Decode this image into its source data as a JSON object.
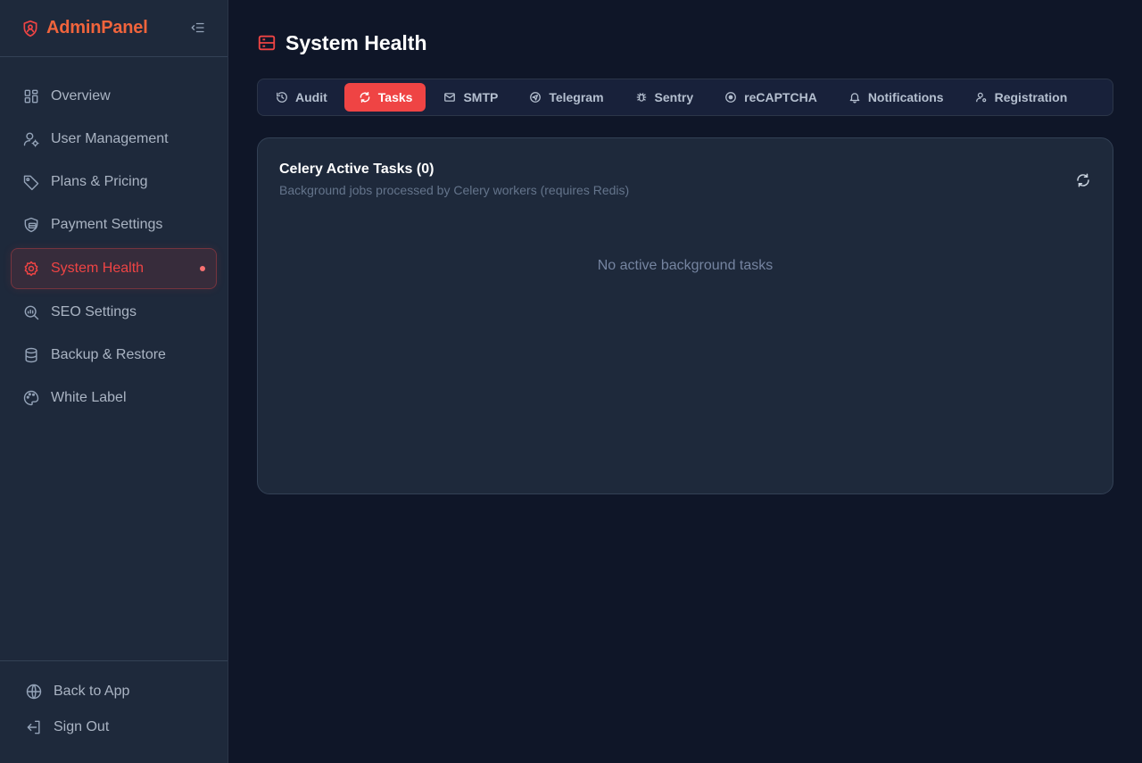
{
  "brand": {
    "name": "AdminPanel"
  },
  "sidebar": {
    "items": [
      {
        "label": "Overview",
        "icon": "grid-icon"
      },
      {
        "label": "User Management",
        "icon": "user-gear-icon"
      },
      {
        "label": "Plans & Pricing",
        "icon": "tag-icon"
      },
      {
        "label": "Payment Settings",
        "icon": "wallet-icon"
      },
      {
        "label": "System Health",
        "icon": "gear-icon",
        "active": true
      },
      {
        "label": "SEO Settings",
        "icon": "search-chart-icon"
      },
      {
        "label": "Backup & Restore",
        "icon": "database-icon"
      },
      {
        "label": "White Label",
        "icon": "palette-icon"
      }
    ],
    "footer": [
      {
        "label": "Back to App",
        "icon": "globe-icon"
      },
      {
        "label": "Sign Out",
        "icon": "sign-out-icon"
      }
    ]
  },
  "page": {
    "title": "System Health"
  },
  "tabs": [
    {
      "label": "Audit",
      "icon": "history-icon"
    },
    {
      "label": "Tasks",
      "icon": "refresh-icon",
      "active": true
    },
    {
      "label": "SMTP",
      "icon": "mail-icon"
    },
    {
      "label": "Telegram",
      "icon": "send-icon"
    },
    {
      "label": "Sentry",
      "icon": "bug-icon"
    },
    {
      "label": "reCAPTCHA",
      "icon": "target-icon"
    },
    {
      "label": "Notifications",
      "icon": "bell-icon"
    },
    {
      "label": "Registration",
      "icon": "user-plus-icon"
    }
  ],
  "card": {
    "title": "Celery Active Tasks (0)",
    "subtitle": "Background jobs processed by Celery workers (requires Redis)",
    "empty": "No active background tasks"
  },
  "colors": {
    "accent": "#ef4444",
    "brand": "#f0643c",
    "background": "#0f1628",
    "sidebar": "#1e293b"
  }
}
